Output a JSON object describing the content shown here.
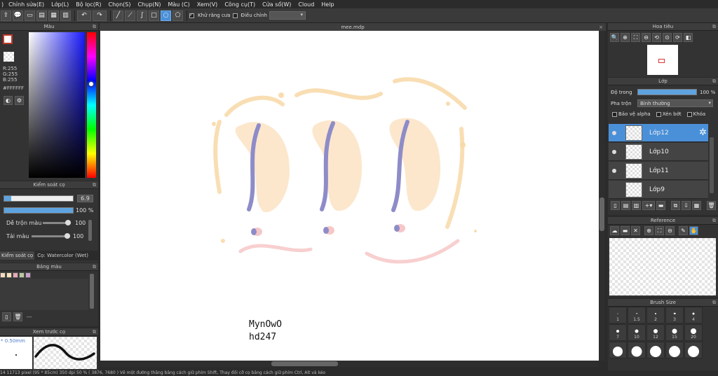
{
  "menu": [
    "Chỉnh sửa(E)",
    "Lớp(L)",
    "Bộ lọc(R)",
    "Chọn(S)",
    "Chụp(N)",
    "Màu (C)",
    "Xem(V)",
    "Công cụ(T)",
    "Cửa sổ(W)",
    "Cloud",
    "Help"
  ],
  "toolbar": {
    "antialias_label": "Khử răng cưa",
    "adjust_label": "Điều chỉnh",
    "adjust_value": ""
  },
  "color_panel": {
    "title": "Màu",
    "r": "R:255",
    "g": "G:255",
    "b": "B:255",
    "hex": "#FFFFFF"
  },
  "brush_control": {
    "title": "Kiểm soát cọ",
    "size_value": "6.9",
    "size_fraction": 0.1,
    "opacity_value": "100 %",
    "opacity_fraction": 1.0,
    "blend_label": "Dễ trộn màu",
    "blend_value": "100",
    "blend_fraction": 1.0,
    "reload_label": "Tải màu",
    "reload_value": "100",
    "reload_fraction": 1.0,
    "tab_label": "Kiểm soát cọ",
    "brush_name": "Cọ: Watercolor (Wet)"
  },
  "palette": {
    "title": "Bảng màu",
    "swatches": [
      "#f5d9c2",
      "#f7e3b9",
      "#e8a8b8",
      "#b8c8a0",
      "#c8a0c8"
    ],
    "more_label": "---"
  },
  "preview": {
    "title": "Xem trước cọ",
    "size_label": "* 0.50mm"
  },
  "document": {
    "title": "mee.mdp",
    "canvas_text_1": "MynOwO",
    "canvas_text_2": "hd247"
  },
  "statusbar": "14 11713 pixel   (95 * 85cm)   350 dpi   50 %   ( 3876, 7680 )   Vẽ một đường thẳng bằng cách giữ phím Shift, Thay đổi cỡ cọ bằng cách giữ phím Ctrl, Alt và kéo",
  "navigator": {
    "title": "Hoa tiêu"
  },
  "layers": {
    "title": "Lớp",
    "opacity_label": "Độ trong",
    "opacity_value": "100 %",
    "opacity_fraction": 1.0,
    "blend_label": "Pha trộn",
    "blend_value": "Bình thường",
    "protect_alpha": "Bảo vệ alpha",
    "clipping": "Xén bớt",
    "lock": "Khóa",
    "items": [
      {
        "name": "Lớp12",
        "selected": true,
        "visible": true
      },
      {
        "name": "Lớp10",
        "selected": false,
        "visible": true
      },
      {
        "name": "Lớp11",
        "selected": false,
        "visible": true
      },
      {
        "name": "Lớp9",
        "selected": false,
        "visible": false
      }
    ]
  },
  "reference": {
    "title": "Reference"
  },
  "brush_size": {
    "title": "Brush Size",
    "sizes": [
      "1",
      "1.5",
      "2",
      "3",
      "4",
      "7",
      "10",
      "12",
      "15",
      "20",
      "",
      "",
      "",
      "",
      ""
    ]
  },
  "colors": {
    "accent": "#4a90d9",
    "panel": "#333333",
    "stroke_orange": "#f8d9a8",
    "stroke_pink": "#f7c7c7",
    "stroke_purple": "#8e8cc8"
  }
}
